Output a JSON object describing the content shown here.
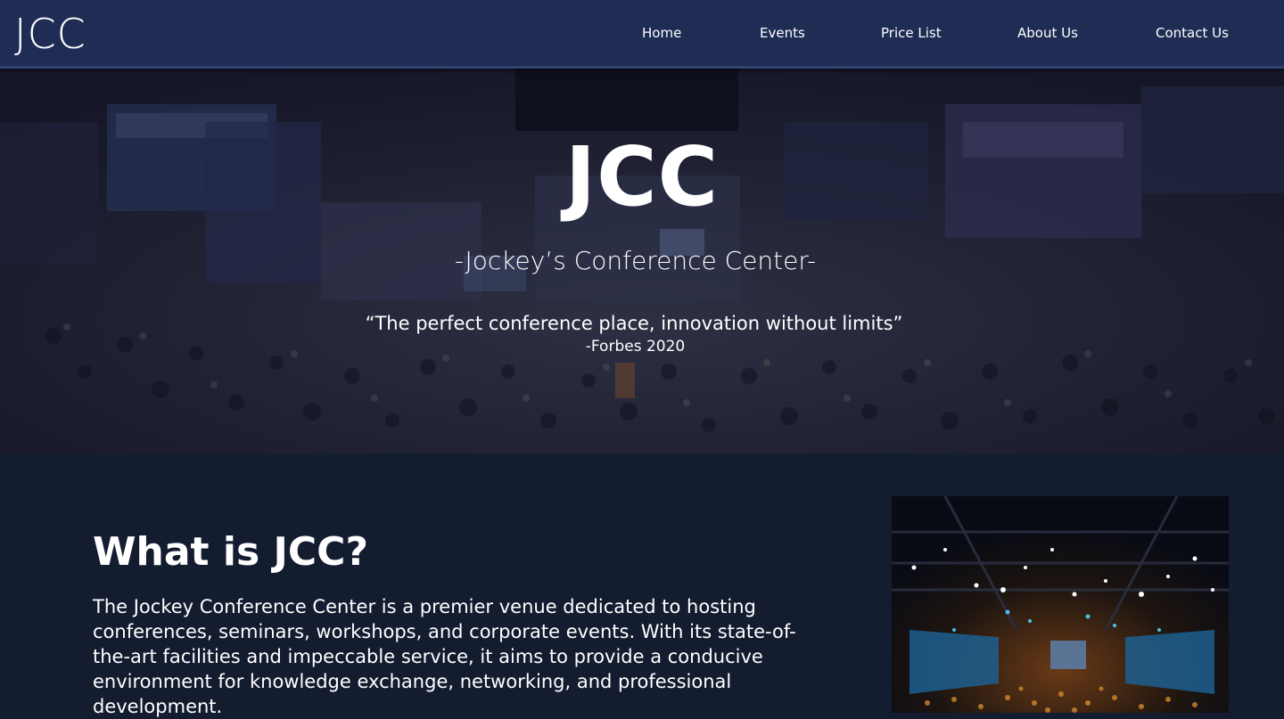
{
  "nav": {
    "logo": "JCC",
    "items": [
      "Home",
      "Events",
      "Price List",
      "About Us",
      "Contact Us"
    ]
  },
  "hero": {
    "title": "JCC",
    "subtitle": "-Jockey’s Conference Center-",
    "quote": "“The perfect conference place, innovation without limits”",
    "attribution": "-Forbes 2020"
  },
  "about": {
    "heading": "What is JCC?",
    "body": "The Jockey Conference Center is a premier venue dedicated to hosting conferences, seminars, workshops, and corporate events. With its state-of-the-art facilities and impeccable service, it aims to provide a conducive environment for knowledge exchange, networking, and professional development."
  },
  "colors": {
    "navbar": "#1f2d55",
    "page_background": "#141c30",
    "text": "#ffffff"
  }
}
